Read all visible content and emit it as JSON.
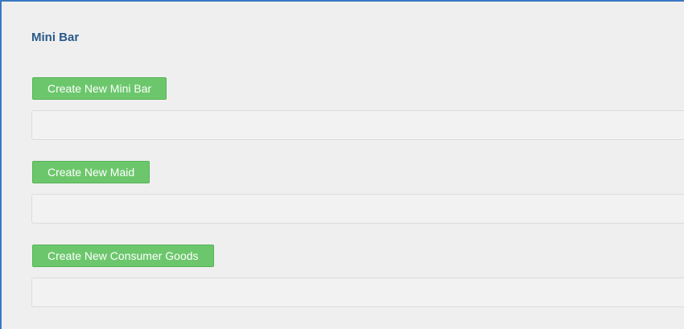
{
  "section": {
    "title": "Mini Bar"
  },
  "groups": [
    {
      "button_label": "Create New Mini Bar"
    },
    {
      "button_label": "Create New Maid"
    },
    {
      "button_label": "Create New Consumer Goods"
    }
  ],
  "colors": {
    "frame_border": "#3a78c2",
    "title": "#2a5a8a",
    "button_bg": "#6cc76c",
    "background": "#efefef"
  }
}
